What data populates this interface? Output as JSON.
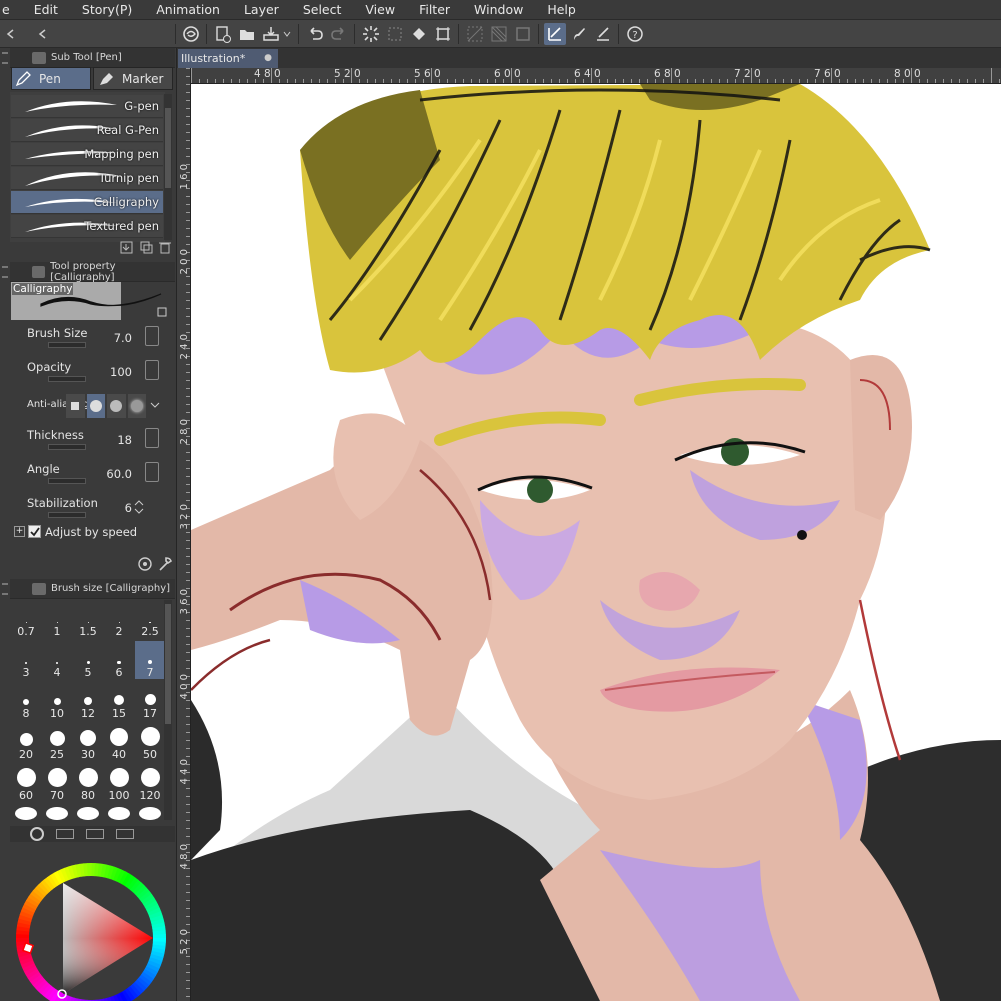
{
  "menu": [
    "e",
    "Edit",
    "Story(P)",
    "Animation",
    "Layer",
    "Select",
    "View",
    "Filter",
    "Window",
    "Help"
  ],
  "document": {
    "tab_title": "Illustration*"
  },
  "subtool_panel": {
    "title": "Sub Tool [Pen]",
    "tabs": [
      "Pen",
      "Marker"
    ],
    "brushes": [
      "G-pen",
      "Real G-Pen",
      "Mapping pen",
      "Turnip pen",
      "Calligraphy",
      "Textured pen"
    ],
    "selected_brush": "Calligraphy"
  },
  "tool_property": {
    "title": "Tool property [Calligraphy]",
    "preview_label": "Calligraphy",
    "brush_size": {
      "label": "Brush Size",
      "value": "7.0"
    },
    "opacity": {
      "label": "Opacity",
      "value": "100"
    },
    "anti_aliasing": {
      "label": "Anti-aliasing"
    },
    "thickness": {
      "label": "Thickness",
      "value": "18"
    },
    "angle": {
      "label": "Angle",
      "value": "60.0"
    },
    "stabilization": {
      "label": "Stabilization",
      "value": "6"
    },
    "adjust_by_speed": {
      "label": "Adjust by speed",
      "checked": true
    }
  },
  "brush_size_panel": {
    "title": "Brush size [Calligraphy]",
    "sizes": [
      "0.7",
      "1",
      "1.5",
      "2",
      "2.5",
      "3",
      "4",
      "5",
      "6",
      "7",
      "8",
      "10",
      "12",
      "15",
      "17",
      "20",
      "25",
      "30",
      "40",
      "50",
      "60",
      "70",
      "80",
      "100",
      "120"
    ],
    "selected": "7"
  },
  "rulers": {
    "h_ticks": [
      "4 8 0",
      "5 2 0",
      "5 6 0",
      "6 0 0",
      "6 4 0",
      "6 8 0",
      "7 2 0",
      "7 6 0",
      "8 0 0"
    ],
    "v_ticks": [
      "1 6 0",
      "2 0 0",
      "2 4 0",
      "2 8 0",
      "3 2 0",
      "3 6 0",
      "4 0 0",
      "4 4 0",
      "4 8 0",
      "5 2 0"
    ]
  },
  "colors": {
    "accent": "#5b6d8a",
    "panel": "#3a3a3a",
    "hair": "#d9c43c",
    "skin": "#e3b8a8",
    "shadow": "#b79be6",
    "shirt": "#2b2b2b"
  }
}
